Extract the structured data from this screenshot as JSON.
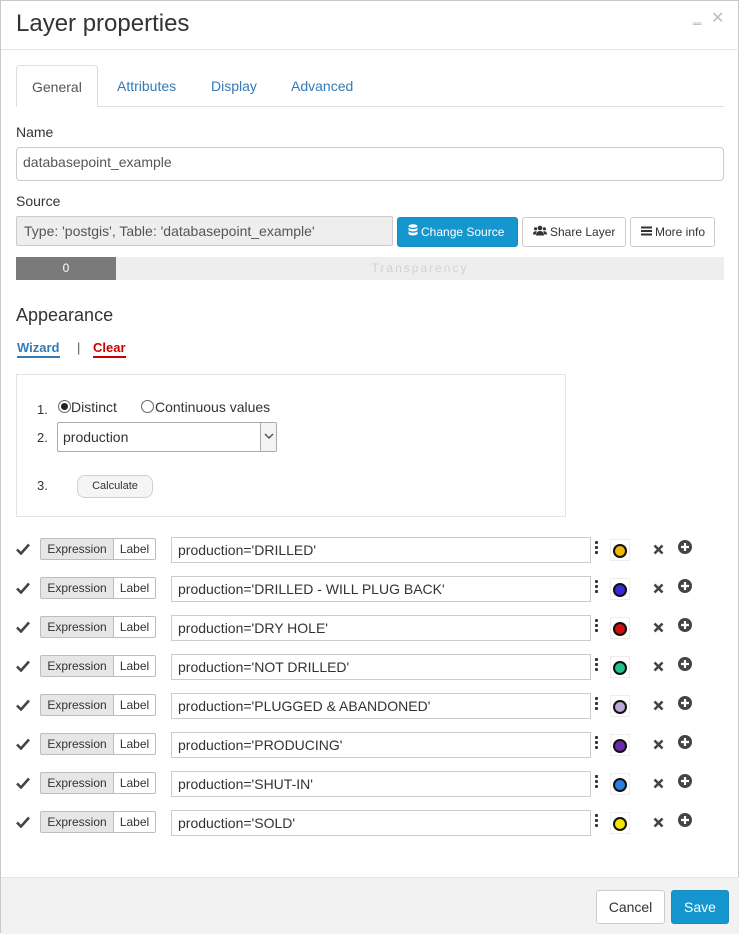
{
  "dialog": {
    "title": "Layer properties",
    "minimize_glyph": "‗",
    "close_glyph": "✕"
  },
  "tabs": [
    {
      "label": "General",
      "active": true
    },
    {
      "label": "Attributes",
      "active": false
    },
    {
      "label": "Display",
      "active": false
    },
    {
      "label": "Advanced",
      "active": false
    }
  ],
  "name": {
    "label": "Name",
    "value": "databasepoint_example"
  },
  "source": {
    "label": "Source",
    "value": "Type: 'postgis', Table: 'databasepoint_example'",
    "change_source_label": "Change Source",
    "share_layer_label": "Share Layer",
    "more_info_label": "More info",
    "icons": [
      "database-icon",
      "users-icon",
      "list-icon"
    ]
  },
  "transparency": {
    "value": "0",
    "label": "Transparency",
    "fraction": 0.0
  },
  "appearance": {
    "heading": "Appearance",
    "wizard_link": "Wizard",
    "separator": "|",
    "clear_link": "Clear"
  },
  "wizard": {
    "step1": "1.",
    "step2": "2.",
    "step3": "3.",
    "option_distinct": "Distinct",
    "option_continuous": "Continuous values",
    "selected_option": "distinct",
    "field_value": "production",
    "calculate_label": "Calculate"
  },
  "rules": [
    {
      "expression_label": "Expression",
      "label_label": "Label",
      "value": "production='DRILLED'",
      "color": "#f2b705"
    },
    {
      "expression_label": "Expression",
      "label_label": "Label",
      "value": "production='DRILLED - WILL PLUG BACK'",
      "color": "#3a2ad6"
    },
    {
      "expression_label": "Expression",
      "label_label": "Label",
      "value": "production='DRY HOLE'",
      "color": "#cc1010"
    },
    {
      "expression_label": "Expression",
      "label_label": "Label",
      "value": "production='NOT DRILLED'",
      "color": "#22c28a"
    },
    {
      "expression_label": "Expression",
      "label_label": "Label",
      "value": "production='PLUGGED & ABANDONED'",
      "color": "#b9a9d6"
    },
    {
      "expression_label": "Expression",
      "label_label": "Label",
      "value": "production='PRODUCING'",
      "color": "#6a2aa8"
    },
    {
      "expression_label": "Expression",
      "label_label": "Label",
      "value": "production='SHUT-IN'",
      "color": "#2c7fe0"
    },
    {
      "expression_label": "Expression",
      "label_label": "Label",
      "value": "production='SOLD'",
      "color": "#f5e400"
    }
  ],
  "footer": {
    "cancel_label": "Cancel",
    "save_label": "Save"
  }
}
